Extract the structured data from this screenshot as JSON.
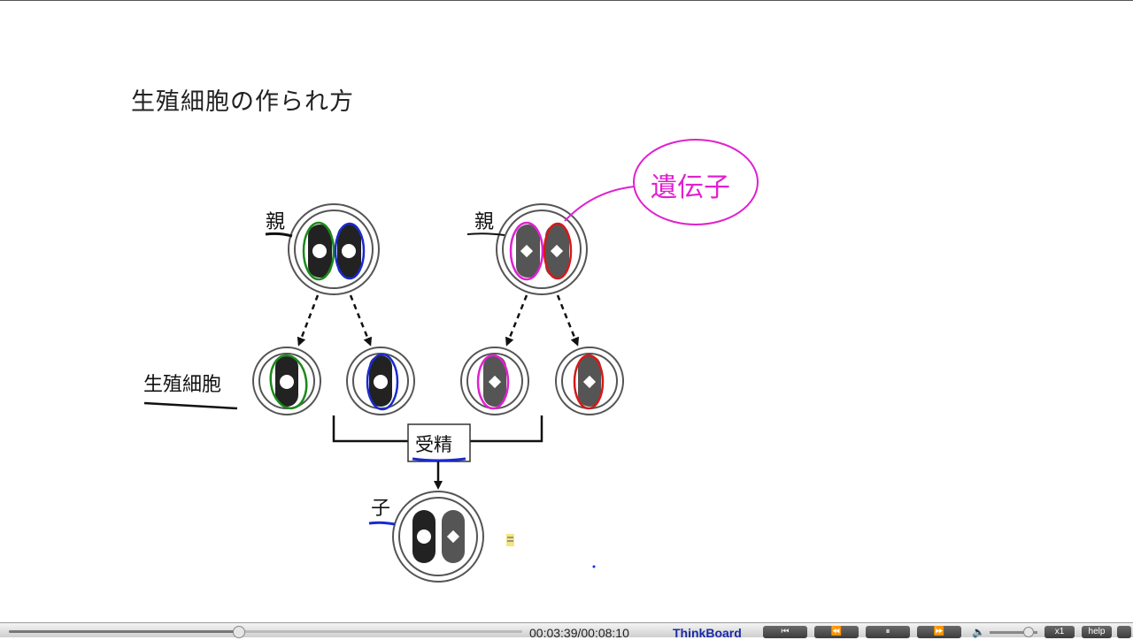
{
  "slide": {
    "title": "生殖細胞の作られ方",
    "labels": {
      "parent_left": "親",
      "parent_right": "親",
      "germ_cell": "生殖細胞",
      "fertilization": "受精",
      "child": "子",
      "gene_annotation": "遺伝子"
    }
  },
  "colors": {
    "chromosome_dark": "#222222",
    "chromosome_gray": "#555555",
    "green_outline": "#1a8a1a",
    "blue_outline": "#1a2ad0",
    "magenta_outline": "#e020d0",
    "red_outline": "#d81818",
    "annotation_pen": "#e020d0",
    "brand": "#1a2aa8"
  },
  "player": {
    "time": "00:03:39/00:08:10",
    "brand": "ThinkBoard",
    "progress_percent": 44.7,
    "buttons": [
      "skip-back",
      "rewind",
      "pause",
      "fast-forward"
    ],
    "speed_label": "x1",
    "help_label": "help"
  }
}
